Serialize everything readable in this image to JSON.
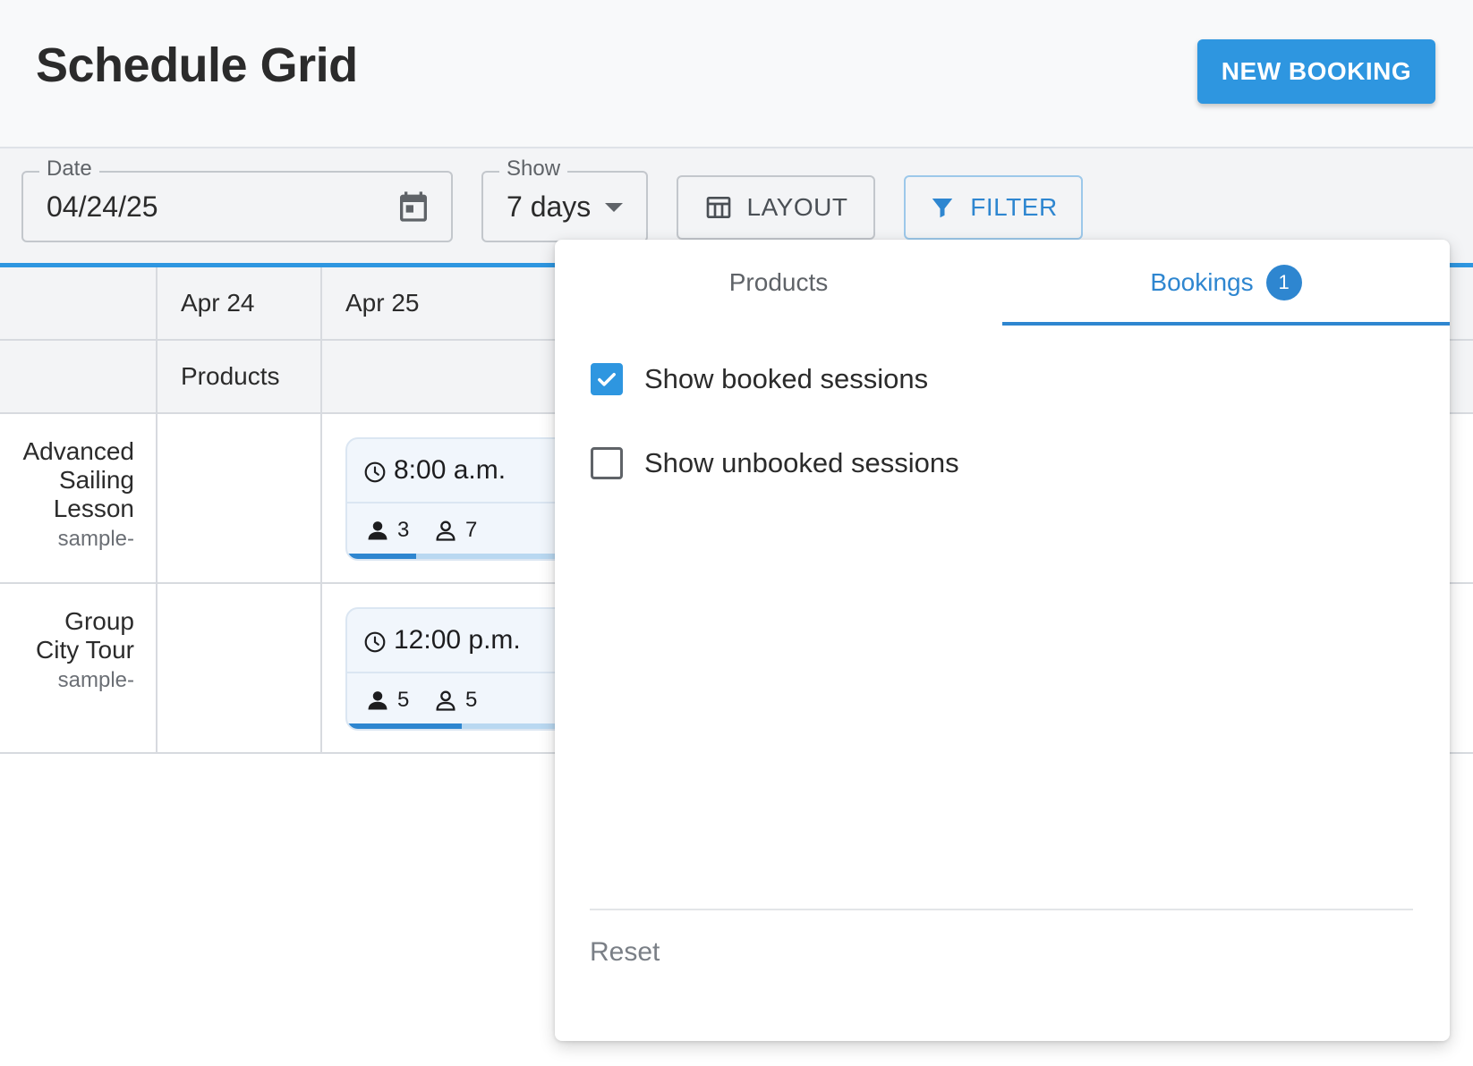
{
  "header": {
    "title": "Schedule Grid",
    "new_booking_label": "NEW BOOKING"
  },
  "toolbar": {
    "date": {
      "label": "Date",
      "value": "04/24/25",
      "icon": "calendar-icon"
    },
    "show": {
      "label": "Show",
      "value": "7 days",
      "icon": "chevron-down-icon"
    },
    "layout_label": "LAYOUT",
    "filter_label": "FILTER"
  },
  "grid": {
    "days": [
      "Apr 24",
      "Apr 25"
    ],
    "subheader": "Products",
    "rows": [
      {
        "name_lines": [
          "Advanced",
          "Sailing",
          "Lesson"
        ],
        "code": "sample-",
        "session": {
          "time": "8:00 a.m.",
          "booked": "3",
          "available": "7",
          "booked_fraction": 0.3
        }
      },
      {
        "name_lines": [
          "Group",
          "City Tour"
        ],
        "code": "sample-",
        "session": {
          "time": "12:00 p.m.",
          "booked": "5",
          "available": "5",
          "booked_fraction": 0.5
        }
      }
    ]
  },
  "filter_popover": {
    "tabs": [
      {
        "label": "Products",
        "active": false
      },
      {
        "label": "Bookings",
        "badge": "1",
        "active": true
      }
    ],
    "options": [
      {
        "label": "Show booked sessions",
        "checked": true
      },
      {
        "label": "Show unbooked sessions",
        "checked": false
      }
    ],
    "reset_label": "Reset"
  },
  "colors": {
    "accent": "#2e96e0",
    "accent_text": "#2e86d0",
    "border": "#d7dadf"
  }
}
